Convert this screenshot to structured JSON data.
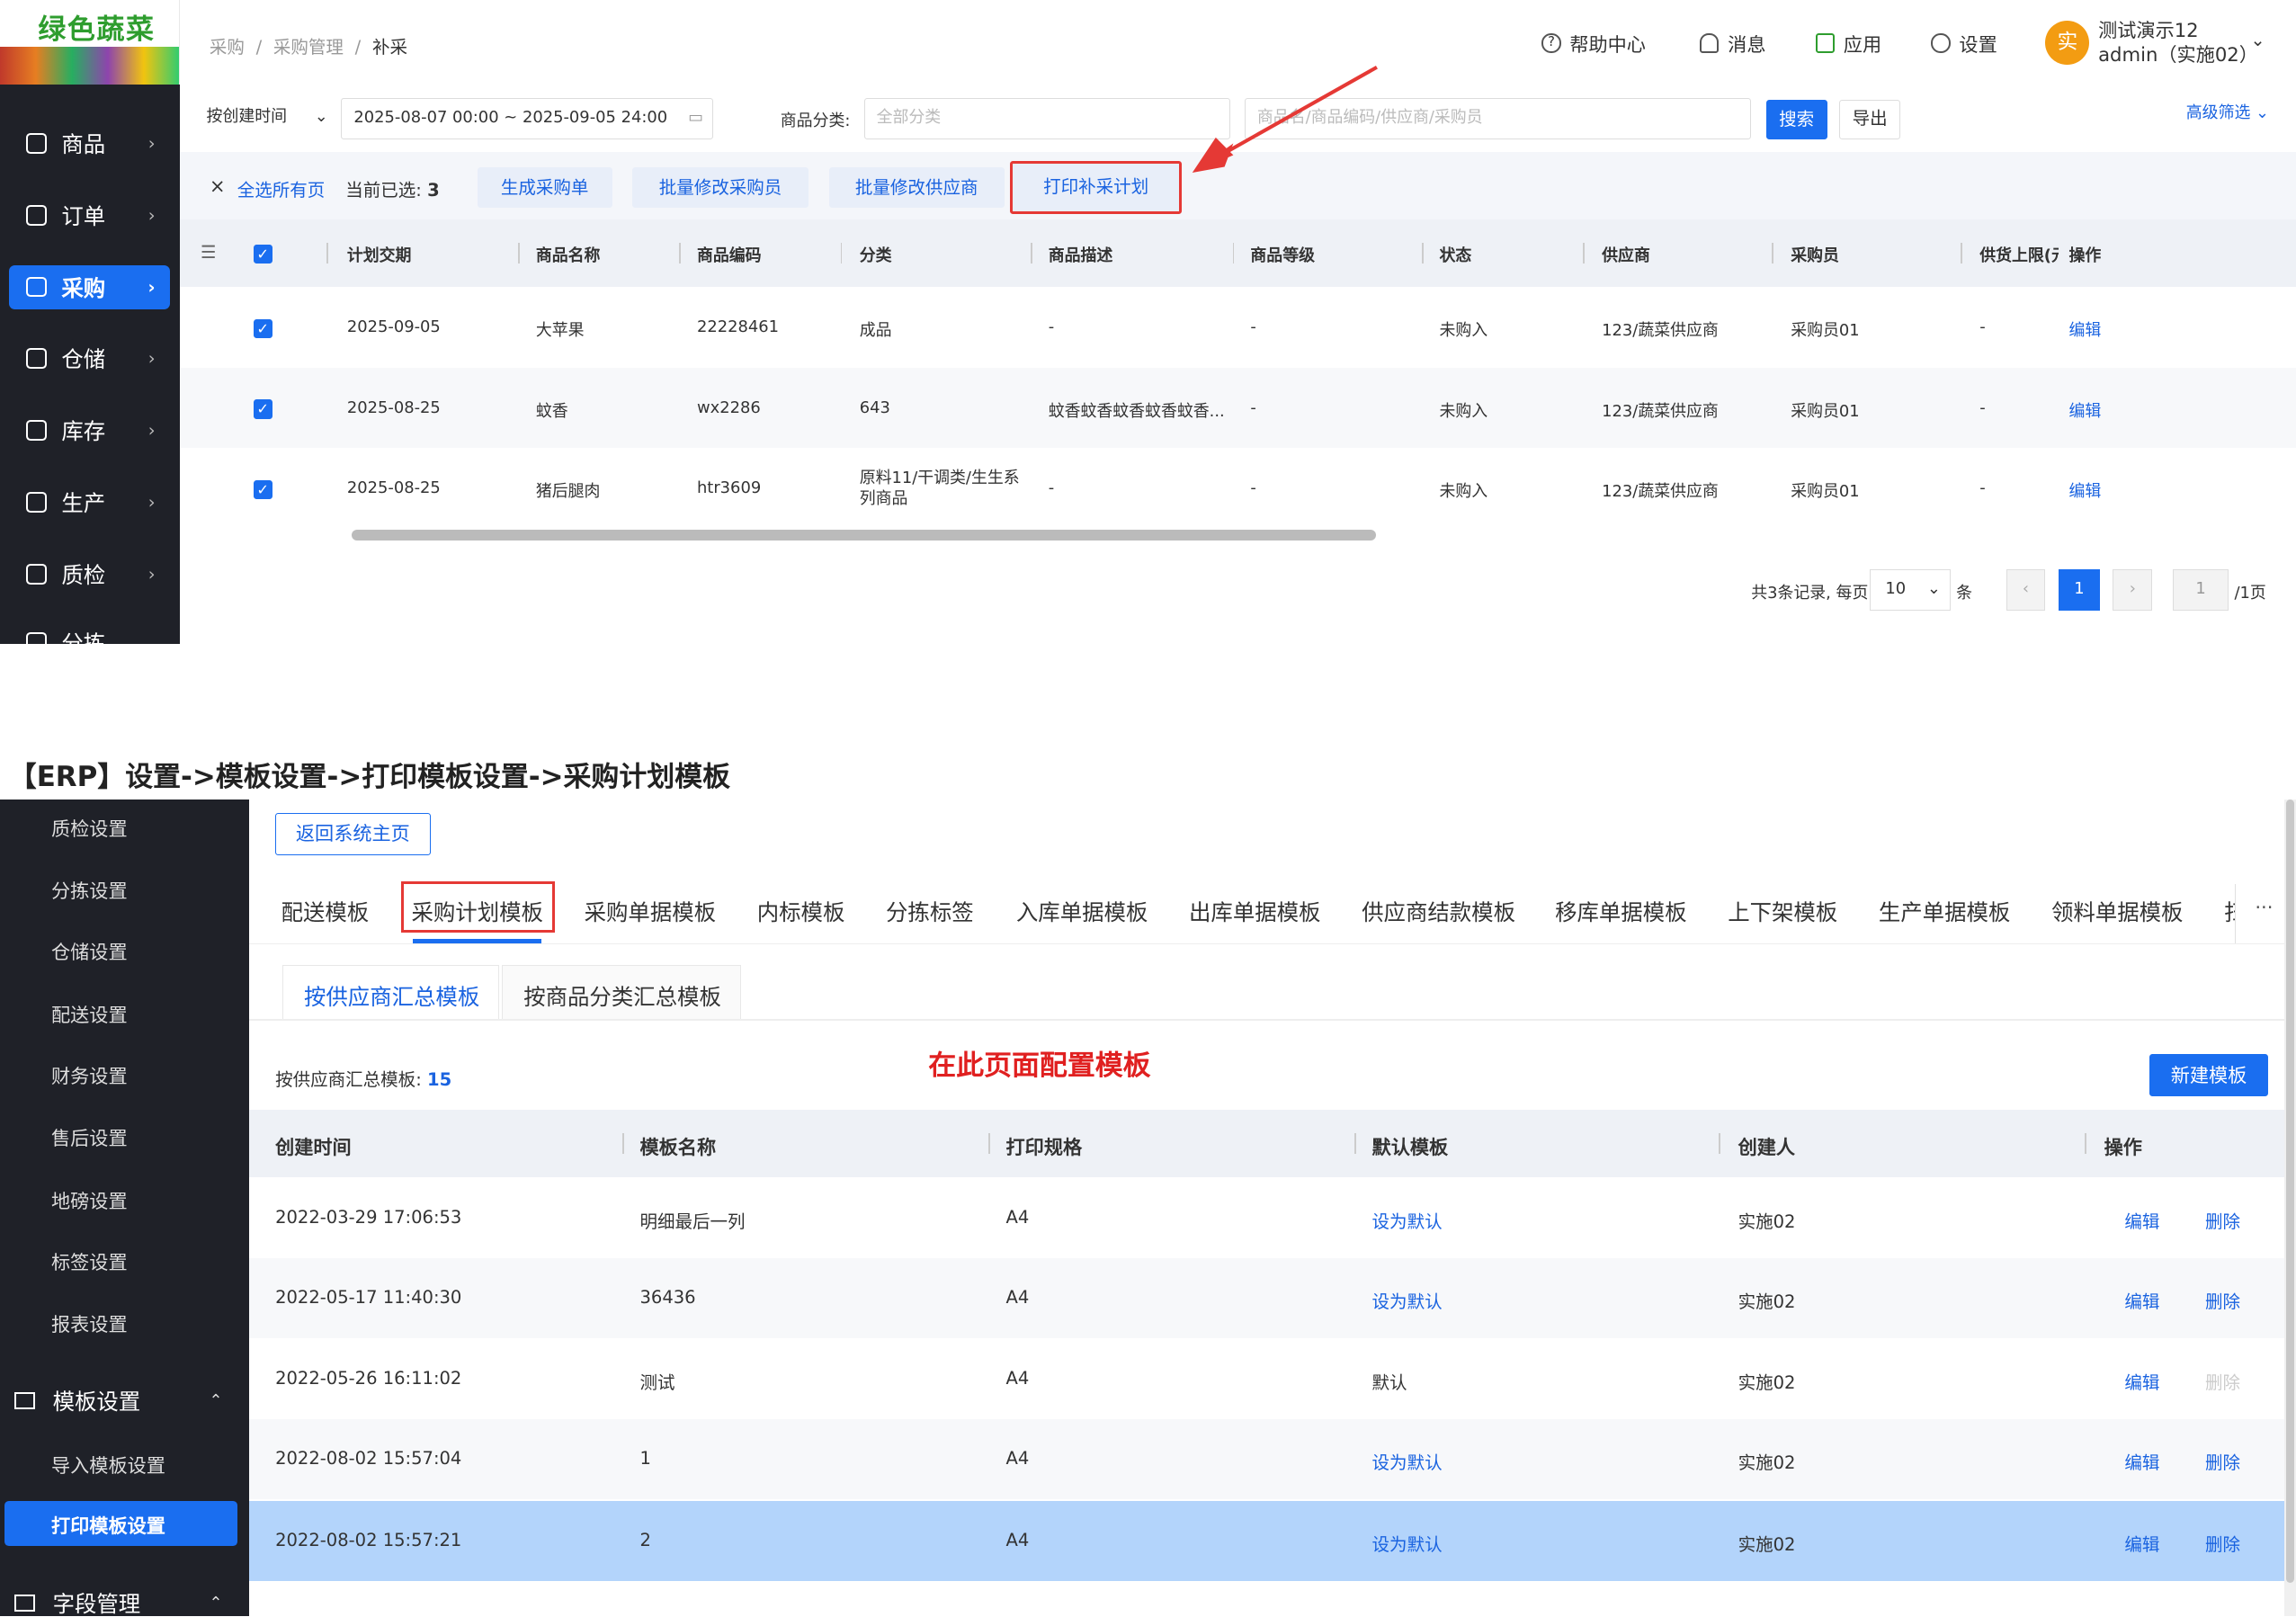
{
  "top": {
    "logo_text": "绿色蔬菜",
    "sidebar": {
      "items": [
        {
          "label": "商品"
        },
        {
          "label": "订单"
        },
        {
          "label": "采购"
        },
        {
          "label": "仓储"
        },
        {
          "label": "库存"
        },
        {
          "label": "生产"
        },
        {
          "label": "质检"
        },
        {
          "label": "分拣"
        }
      ]
    },
    "header": {
      "breadcrumb": [
        "采购",
        "采购管理",
        "补采"
      ],
      "breadcrumb_sep": "/",
      "tools": [
        "帮助中心",
        "消息",
        "应用",
        "设置"
      ],
      "avatar_initial": "实",
      "user_line1": "测试演示12",
      "user_line2": "admin（实施02）"
    },
    "filter": {
      "date_type": "按创建时间",
      "date_range": "2025-08-07 00:00 ~ 2025-09-05 24:00",
      "category_label": "商品分类:",
      "category_placeholder": "全部分类",
      "search_placeholder": "商品名/商品编码/供应商/采购员",
      "search_button": "搜索",
      "export_button": "导出",
      "advanced_filter": "高级筛选"
    },
    "actions": {
      "close": "×",
      "select_all_pages": "全选所有页",
      "selected_prefix": "当前已选:",
      "selected_count": "3",
      "buttons": [
        "生成采购单",
        "批量修改采购员",
        "批量修改供应商",
        "打印补采计划"
      ]
    },
    "table": {
      "columns": [
        "计划交期",
        "商品名称",
        "商品编码",
        "分类",
        "商品描述",
        "商品等级",
        "状态",
        "供应商",
        "采购员",
        "供货上限(元",
        "操作"
      ],
      "rows": [
        {
          "date": "2025-09-05",
          "name": "大苹果",
          "code": "22228461",
          "category": "成品",
          "desc": "-",
          "grade": "-",
          "status": "未购入",
          "supplier": "123/蔬菜供应商",
          "buyer": "采购员01",
          "limit": "-",
          "op": "编辑"
        },
        {
          "date": "2025-08-25",
          "name": "蚊香",
          "code": "wx2286",
          "category": "643",
          "desc": "蚊香蚊香蚊香蚊香蚊香...",
          "grade": "-",
          "status": "未购入",
          "supplier": "123/蔬菜供应商",
          "buyer": "采购员01",
          "limit": "-",
          "op": "编辑"
        },
        {
          "date": "2025-08-25",
          "name": "猪后腿肉",
          "code": "htr3609",
          "category": "原料11/干调类/生生系列商品",
          "desc": "-",
          "grade": "-",
          "status": "未购入",
          "supplier": "123/蔬菜供应商",
          "buyer": "采购员01",
          "limit": "-",
          "op": "编辑"
        }
      ]
    },
    "pagination": {
      "total_text": "共3条记录, 每页",
      "page_size": "10",
      "unit": "条",
      "prev": "‹",
      "current": "1",
      "next": "›",
      "jump_value": "1",
      "total_pages": "/1页"
    }
  },
  "caption": "【ERP】设置->模板设置->打印模板设置->采购计划模板",
  "bottom": {
    "sidebar": {
      "items": [
        "质检设置",
        "分拣设置",
        "仓储设置",
        "配送设置",
        "财务设置",
        "售后设置",
        "地磅设置",
        "标签设置",
        "报表设置"
      ],
      "group": "模板设置",
      "sub_items": [
        "导入模板设置",
        "打印模板设置"
      ],
      "group2": "字段管理"
    },
    "back_button": "返回系统主页",
    "tabs": [
      "配送模板",
      "采购计划模板",
      "采购单据模板",
      "内标模板",
      "分拣标签",
      "入库单据模板",
      "出库单据模板",
      "供应商结款模板",
      "移库单据模板",
      "上下架模板",
      "生产单据模板",
      "领料单据模板",
      "扫"
    ],
    "tabs_more": "···",
    "subtabs": [
      "按供应商汇总模板",
      "按商品分类汇总模板"
    ],
    "count_label": "按供应商汇总模板:",
    "count_value": "15",
    "annotation": "在此页面配置模板",
    "new_button": "新建模板",
    "table": {
      "columns": [
        "创建时间",
        "模板名称",
        "打印规格",
        "默认模板",
        "创建人",
        "操作"
      ],
      "rows": [
        {
          "time": "2022-03-29 17:06:53",
          "name": "明细最后一列",
          "spec": "A4",
          "default": "设为默认",
          "is_default": false,
          "creator": "实施02",
          "edit": "编辑",
          "delete": "删除"
        },
        {
          "time": "2022-05-17 11:40:30",
          "name": "36436",
          "spec": "A4",
          "default": "设为默认",
          "is_default": false,
          "creator": "实施02",
          "edit": "编辑",
          "delete": "删除"
        },
        {
          "time": "2022-05-26 16:11:02",
          "name": "测试",
          "spec": "A4",
          "default": "默认",
          "is_default": true,
          "creator": "实施02",
          "edit": "编辑",
          "delete": "删除"
        },
        {
          "time": "2022-08-02 15:57:04",
          "name": "1",
          "spec": "A4",
          "default": "设为默认",
          "is_default": false,
          "creator": "实施02",
          "edit": "编辑",
          "delete": "删除"
        },
        {
          "time": "2022-08-02 15:57:21",
          "name": "2",
          "spec": "A4",
          "default": "设为默认",
          "is_default": false,
          "creator": "实施02",
          "edit": "编辑",
          "delete": "删除"
        }
      ]
    }
  },
  "colors": {
    "primary": "#1a6ef0",
    "sidebar": "#1f2128",
    "highlight_row": "#b3d4fb",
    "annotation": "#e02020"
  }
}
